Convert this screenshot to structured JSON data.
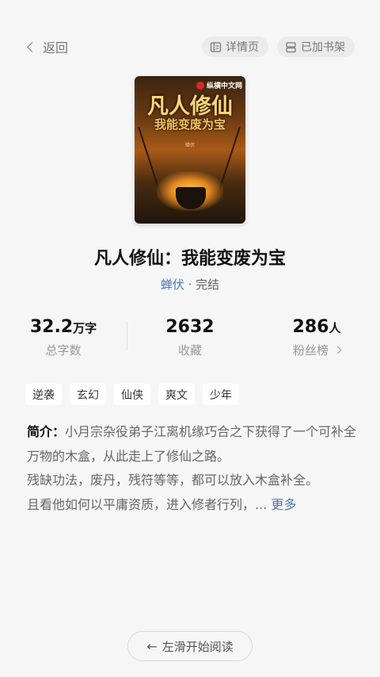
{
  "header": {
    "back_label": "返回",
    "detail_label": "详情页",
    "shelf_label": "已加书架"
  },
  "cover": {
    "publisher": "纵横中文网",
    "title_line1": "凡人修仙",
    "title_line2": "我能变废为宝",
    "author": "蝉伏"
  },
  "book": {
    "title": "凡人修仙：我能变废为宝",
    "author": "蝉伏",
    "separator": "·",
    "status": "完结"
  },
  "stats": [
    {
      "value": "32.2",
      "unit": "万字",
      "label": "总字数"
    },
    {
      "value": "2632",
      "unit": "",
      "label": "收藏"
    },
    {
      "value": "286",
      "unit": "人",
      "label": "粉丝榜"
    }
  ],
  "tags": [
    "逆袭",
    "玄幻",
    "仙侠",
    "爽文",
    "少年"
  ],
  "intro": {
    "label": "简介：",
    "line1": "小月宗杂役弟子江离机缘巧合之下获得了一个可补全万物的木盒，从此走上了修仙之路。",
    "line2": "残缺功法，废丹，残符等等，都可以放入木盒补全。",
    "line3": "且看他如何以平庸资质，进入修者行列，...",
    "more": "更多"
  },
  "footer": {
    "start_label": "左滑开始阅读"
  },
  "colors": {
    "background": "#f6f6f6",
    "link": "#4a78b8"
  }
}
